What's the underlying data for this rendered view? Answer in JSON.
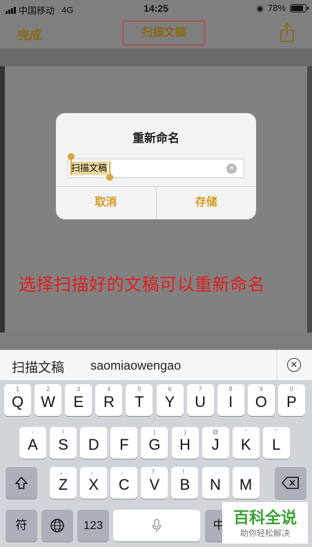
{
  "status_bar": {
    "carrier": "中国移动",
    "network": "4G",
    "time": "14:25",
    "battery": "78%"
  },
  "nav": {
    "done_label": "完成",
    "title": "扫描文稿",
    "share_icon": "share-icon"
  },
  "dialog": {
    "title": "重新命名",
    "input_value": "扫描文稿",
    "cancel_label": "取消",
    "save_label": "存储"
  },
  "caption": "选择扫描好的文稿可以重新命名",
  "candidates": {
    "word": "扫描文稿",
    "pinyin": "saomiaowengao"
  },
  "keyboard": {
    "row1": [
      {
        "main": "Q",
        "sub": "1"
      },
      {
        "main": "W",
        "sub": "2"
      },
      {
        "main": "E",
        "sub": "3"
      },
      {
        "main": "R",
        "sub": "4"
      },
      {
        "main": "T",
        "sub": "5"
      },
      {
        "main": "Y",
        "sub": "6"
      },
      {
        "main": "U",
        "sub": "7"
      },
      {
        "main": "I",
        "sub": "8"
      },
      {
        "main": "O",
        "sub": "9"
      },
      {
        "main": "P",
        "sub": "0"
      }
    ],
    "row2": [
      {
        "main": "A",
        "sub": "-"
      },
      {
        "main": "S",
        "sub": "/"
      },
      {
        "main": "D",
        "sub": ":"
      },
      {
        "main": "F",
        "sub": ";"
      },
      {
        "main": "G",
        "sub": "("
      },
      {
        "main": "H",
        "sub": ")"
      },
      {
        "main": "J",
        "sub": "@"
      },
      {
        "main": "K",
        "sub": "“"
      },
      {
        "main": "L",
        "sub": "”"
      }
    ],
    "row3": [
      {
        "main": "Z",
        "sub": "。"
      },
      {
        "main": "X",
        "sub": "，"
      },
      {
        "main": "C",
        "sub": "、"
      },
      {
        "main": "V",
        "sub": "？"
      },
      {
        "main": "B",
        "sub": "！"
      },
      {
        "main": "N",
        "sub": "."
      },
      {
        "main": "M",
        "sub": ""
      }
    ],
    "symbol_label": "符",
    "number_label": "123",
    "lang_label": "中"
  },
  "watermark": {
    "big": "百科全说",
    "small": "助你轻松解决"
  },
  "colors": {
    "accent": "#d39a1f",
    "caption_red": "#e02020",
    "watermark_green": "#3aa233"
  }
}
